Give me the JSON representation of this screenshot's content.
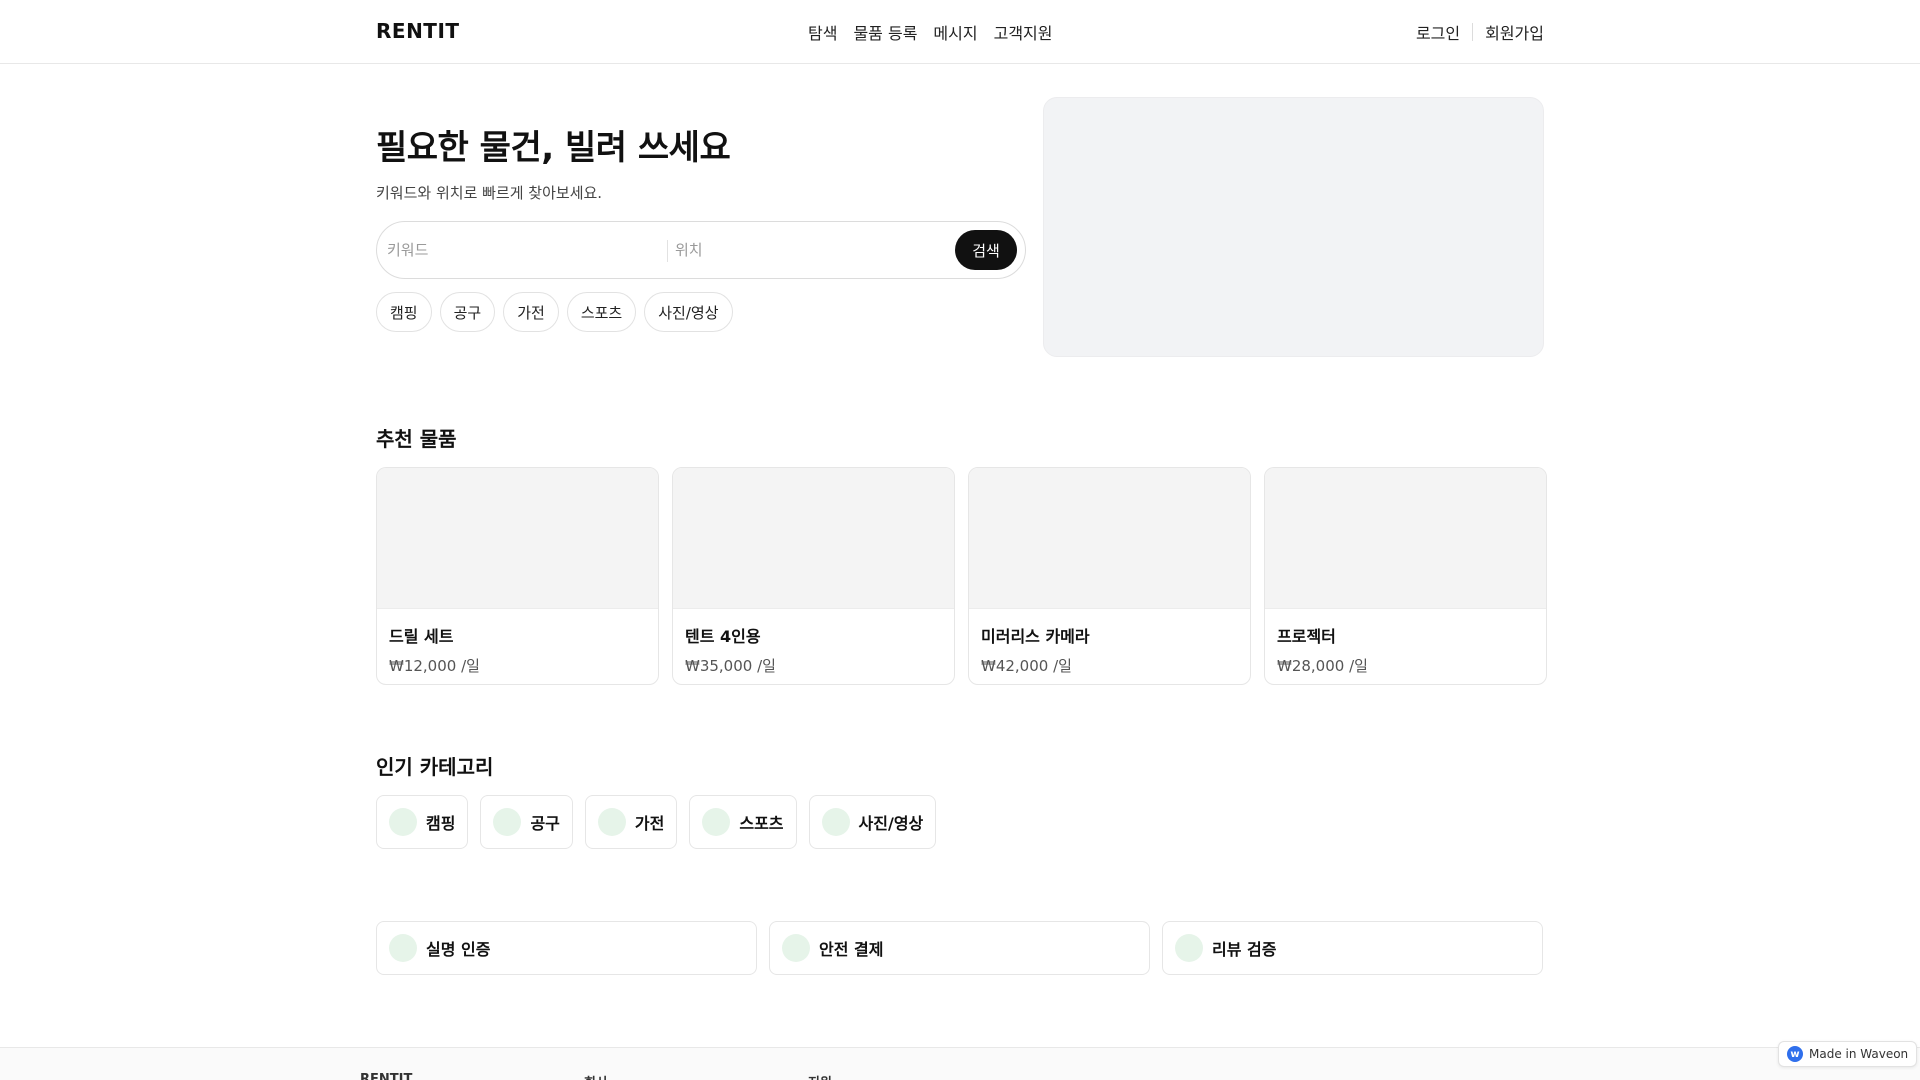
{
  "header": {
    "logo": "RENTIT",
    "nav": [
      "탐색",
      "물품 등록",
      "메시지",
      "고객지원"
    ],
    "login": "로그인",
    "signup": "회원가입"
  },
  "hero": {
    "title": "필요한 물건, 빌려 쓰세요",
    "subtitle": "키워드와 위치로 빠르게 찾아보세요.",
    "keyword_placeholder": "키워드",
    "location_placeholder": "위치",
    "search_button": "검색",
    "chips": [
      "캠핑",
      "공구",
      "가전",
      "스포츠",
      "사진/영상"
    ]
  },
  "featured": {
    "title": "추천 물품",
    "items": [
      {
        "name": "드릴 세트",
        "price": "₩12,000 /일"
      },
      {
        "name": "텐트 4인용",
        "price": "₩35,000 /일"
      },
      {
        "name": "미러리스 카메라",
        "price": "₩42,000 /일"
      },
      {
        "name": "프로젝터",
        "price": "₩28,000 /일"
      }
    ]
  },
  "categories": {
    "title": "인기 카테고리",
    "items": [
      "캠핑",
      "공구",
      "가전",
      "스포츠",
      "사진/영상"
    ]
  },
  "trust": [
    "실명 인증",
    "안전 결제",
    "리뷰 검증"
  ],
  "footer": {
    "columns": [
      "RENTIT",
      "회사",
      "지원"
    ]
  },
  "badge": {
    "text": "Made in Waveon",
    "icon": "waveon-logo-icon",
    "icon_glyph": "w"
  },
  "colors": {
    "accent": "#111111",
    "icon_tint": "#e6f4e9",
    "placeholder_bg": "#f2f3f5",
    "badge_icon": "#2f6fec"
  }
}
